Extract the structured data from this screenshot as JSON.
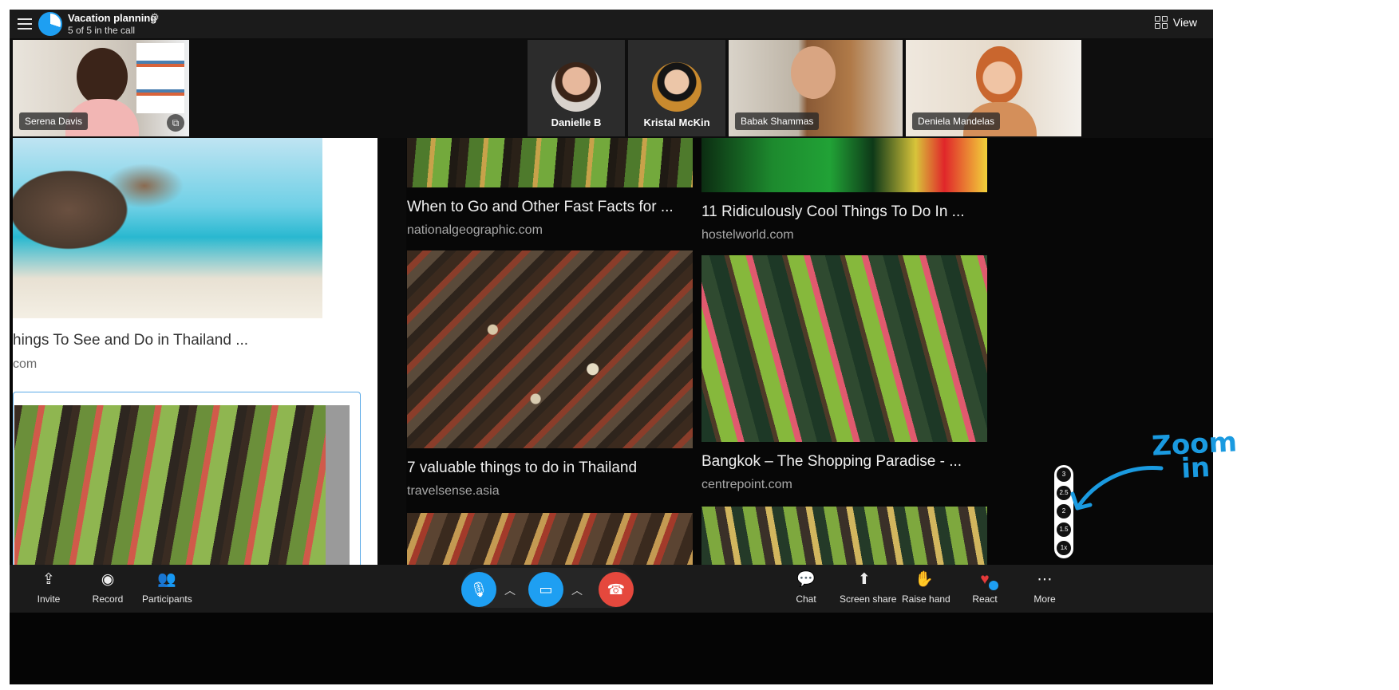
{
  "topbar": {
    "title": "Vacation planning",
    "subtitle": "5 of 5 in the call",
    "view_label": "View"
  },
  "participants": {
    "self": {
      "name": "Serena Davis"
    },
    "tiles": [
      {
        "name": "Danielle B"
      },
      {
        "name": "Kristal McKin"
      },
      {
        "name": "Babak Shammas"
      },
      {
        "name": "Deniela Mandelas"
      }
    ]
  },
  "shared": {
    "left": {
      "title": "hings To See and Do in Thailand ...",
      "source": "com"
    },
    "cards": [
      {
        "title": "When to Go and Other Fast Facts for ...",
        "source": "nationalgeographic.com"
      },
      {
        "title": "11 Ridiculously Cool Things To Do In ...",
        "source": "hostelworld.com"
      },
      {
        "title": "7 valuable things to do in Thailand",
        "source": "travelsense.asia"
      },
      {
        "title": "Bangkok – The Shopping Paradise - ...",
        "source": "centrepoint.com"
      }
    ]
  },
  "zoom": {
    "steps": [
      "3",
      "2.5",
      "2",
      "1.5",
      "1x"
    ]
  },
  "toolbar": {
    "invite": "Invite",
    "record": "Record",
    "participants": "Participants",
    "chat": "Chat",
    "screen_share": "Screen share",
    "raise_hand": "Raise hand",
    "react": "React",
    "more": "More"
  },
  "annotation": {
    "line1": "Zoom",
    "line2": "in"
  },
  "colors": {
    "accent": "#1e9ff2",
    "hangup": "#e5483d",
    "annotation": "#1a9ae0"
  }
}
